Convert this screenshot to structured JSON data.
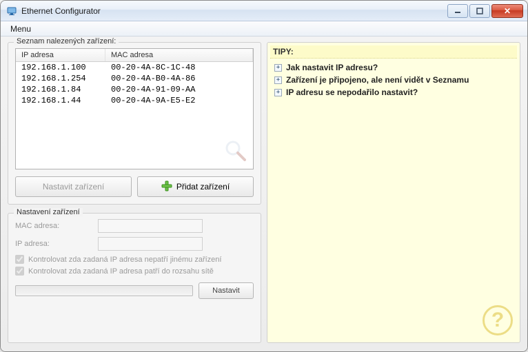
{
  "window": {
    "title": "Ethernet Configurator"
  },
  "menubar": {
    "menu": "Menu"
  },
  "list": {
    "legend": "Seznam nalezených zařízení:",
    "col_ip": "IP adresa",
    "col_mac": "MAC adresa",
    "rows": [
      {
        "ip": "192.168.1.100",
        "mac": "00-20-4A-8C-1C-48"
      },
      {
        "ip": "192.168.1.254",
        "mac": "00-20-4A-B0-4A-86"
      },
      {
        "ip": "192.168.1.84",
        "mac": "00-20-4A-91-09-AA"
      },
      {
        "ip": "192.168.1.44",
        "mac": "00-20-4A-9A-E5-E2"
      }
    ]
  },
  "buttons": {
    "set_device": "Nastavit zařízení",
    "add_device": "Přidat zařízení",
    "apply": "Nastavit"
  },
  "settings": {
    "legend": "Nastavení zařízení",
    "mac_label": "MAC adresa:",
    "ip_label": "IP adresa:",
    "check1": "Kontrolovat zda zadaná IP adresa nepatří jinému zařízení",
    "check2": "Kontrolovat zda zadaná IP adresa patří do rozsahu sítě"
  },
  "tips": {
    "title": "TIPY:",
    "items": [
      "Jak nastavit IP adresu?",
      "Zařízení je připojeno, ale není vidět v Seznamu",
      "IP adresu se nepodařilo nastavit?"
    ]
  }
}
